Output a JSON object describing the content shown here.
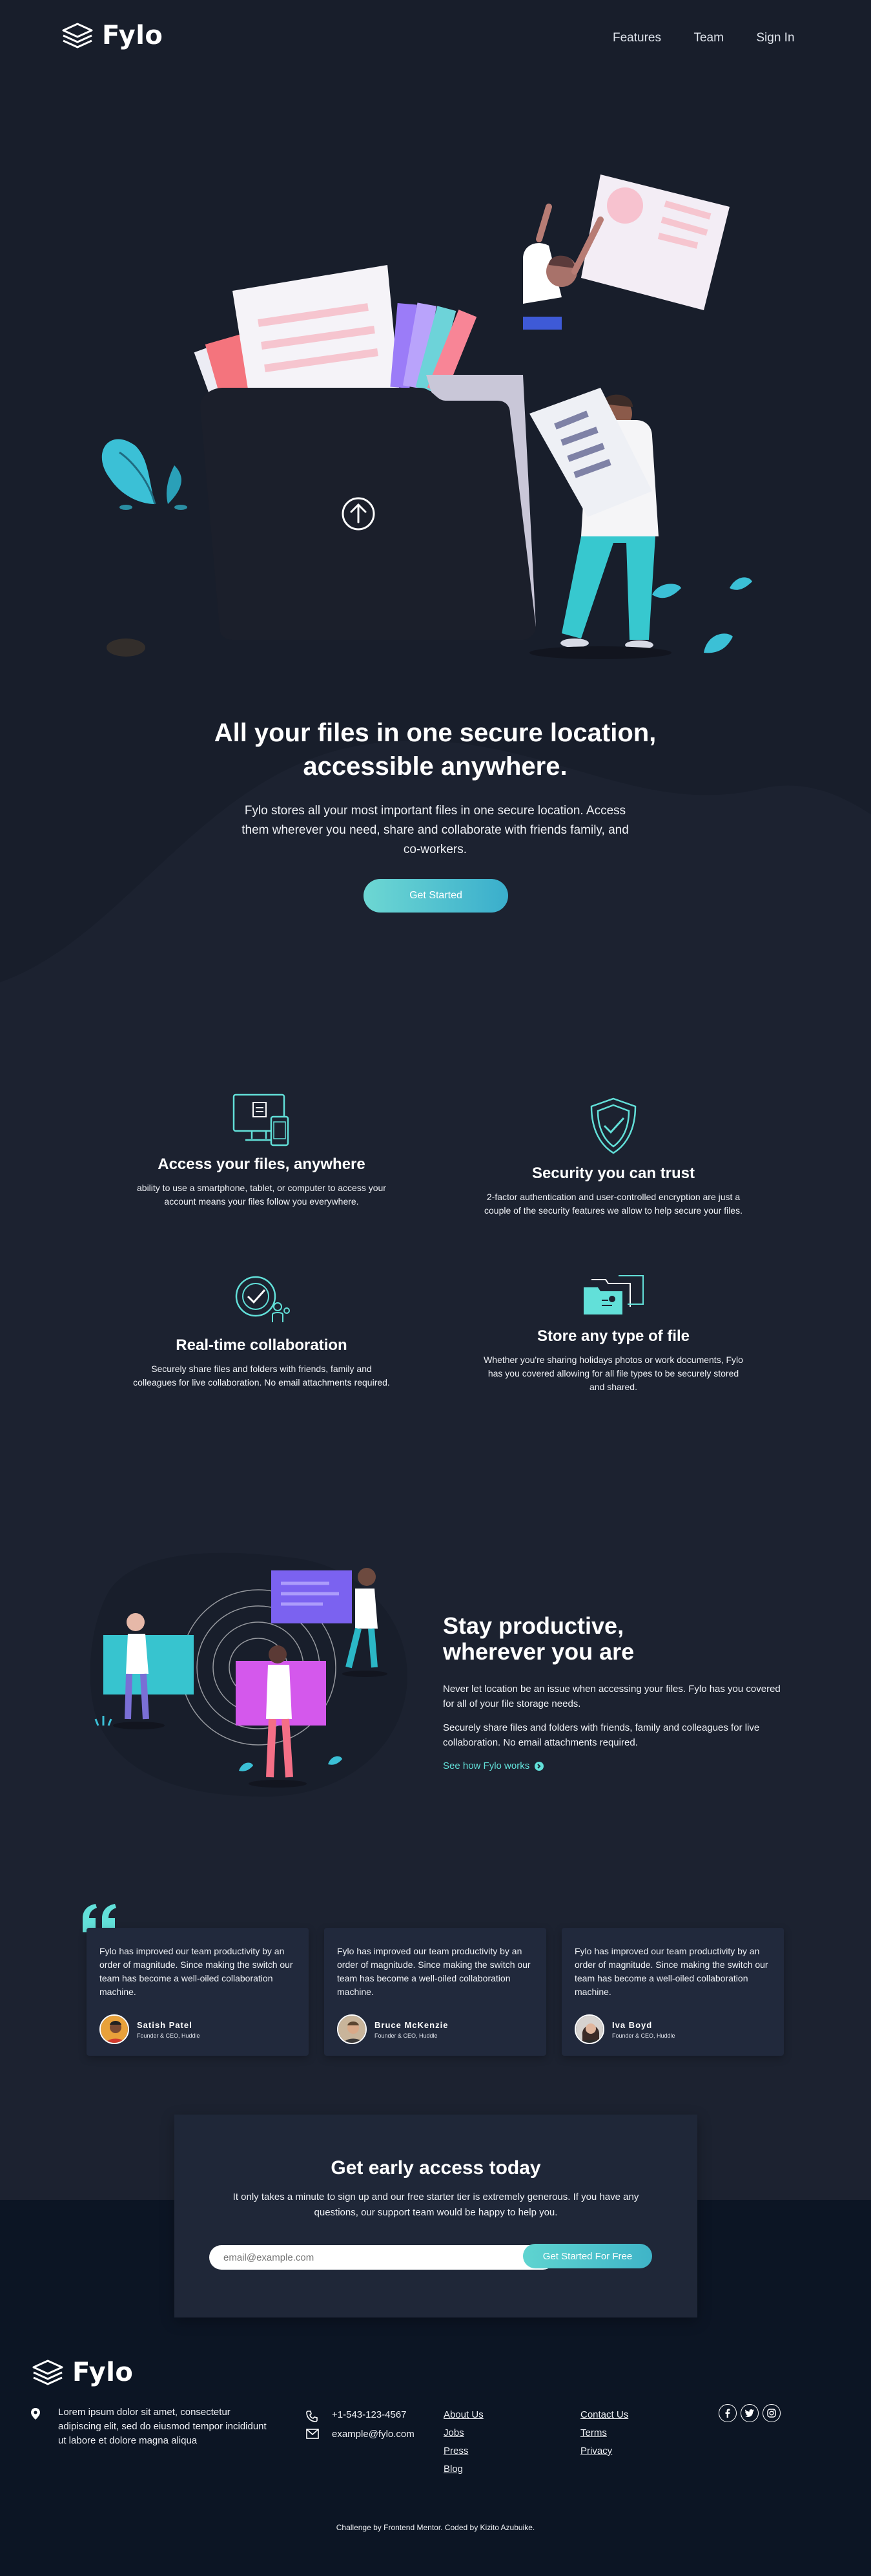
{
  "header": {
    "brand": "Fylo",
    "nav": [
      "Features",
      "Team",
      "Sign In"
    ]
  },
  "hero": {
    "title_line1": "All your files in one secure location,",
    "title_line2": "accessible anywhere.",
    "text": "Fylo stores all your most important files in one secure location. Access them wherever you need, share and collaborate with friends family, and co-workers.",
    "cta": "Get Started"
  },
  "features": [
    {
      "title": "Access your files, anywhere",
      "text": "ability to use a smartphone, tablet, or computer to access your account means your files follow you everywhere.",
      "icon": "devices-icon"
    },
    {
      "title": "Security you can trust",
      "text": "2-factor authentication and user-controlled encryption are just a couple of the security features we allow to help secure your files.",
      "icon": "shield-icon"
    },
    {
      "title": "Real-time collaboration",
      "text": "Securely share files and folders with friends, family and colleagues for live collaboration. No email attachments required.",
      "icon": "collaboration-icon"
    },
    {
      "title": "Store any type of file",
      "text": "Whether you're sharing holidays photos or work documents, Fylo has you covered allowing for all file types to be securely stored and shared.",
      "icon": "folders-icon"
    }
  ],
  "productive": {
    "title_line1": "Stay productive,",
    "title_line2": "wherever you are",
    "p1": "Never let location be an issue when accessing your files. Fylo has you covered for all of your file storage needs.",
    "p2": "Securely share files and folders with friends, family and colleagues for live collaboration. No email attachments required.",
    "link": "See how Fylo works"
  },
  "testimonials": [
    {
      "quote": "Fylo has improved our team productivity by an order of magnitude. Since making the switch our team has become a well-oiled collaboration machine.",
      "name": "Satish Patel",
      "role": "Founder & CEO, Huddle"
    },
    {
      "quote": "Fylo has improved our team productivity by an order of magnitude. Since making the switch our team has become a well-oiled collaboration machine.",
      "name": "Bruce McKenzie",
      "role": "Founder & CEO, Huddle"
    },
    {
      "quote": "Fylo has improved our team productivity by an order of magnitude. Since making the switch our team has become a well-oiled collaboration machine.",
      "name": "Iva Boyd",
      "role": "Founder & CEO, Huddle"
    }
  ],
  "cta": {
    "title": "Get early access today",
    "text": "It only takes a minute to sign up and our free starter tier is extremely generous. If you have any questions, our support team would be happy to help you.",
    "placeholder": "email@example.com",
    "button": "Get Started For Free"
  },
  "footer": {
    "brand": "Fylo",
    "address": "Lorem ipsum dolor sit amet, consectetur adipiscing elit, sed do eiusmod tempor incididunt ut labore et dolore magna aliqua",
    "phone": "+1-543-123-4567",
    "email": "example@fylo.com",
    "col1": [
      "About Us",
      "Jobs",
      "Press",
      "Blog"
    ],
    "col2": [
      "Contact Us",
      "Terms",
      "Privacy"
    ],
    "social": [
      "facebook-icon",
      "twitter-icon",
      "instagram-icon"
    ],
    "attribution": "Challenge by Frontend Mentor. Coded by Kizito Azubuike."
  },
  "colors": {
    "background": "#1c2230",
    "footer": "#0c1524",
    "accent": "#62e0d9",
    "card": "#21293c"
  }
}
